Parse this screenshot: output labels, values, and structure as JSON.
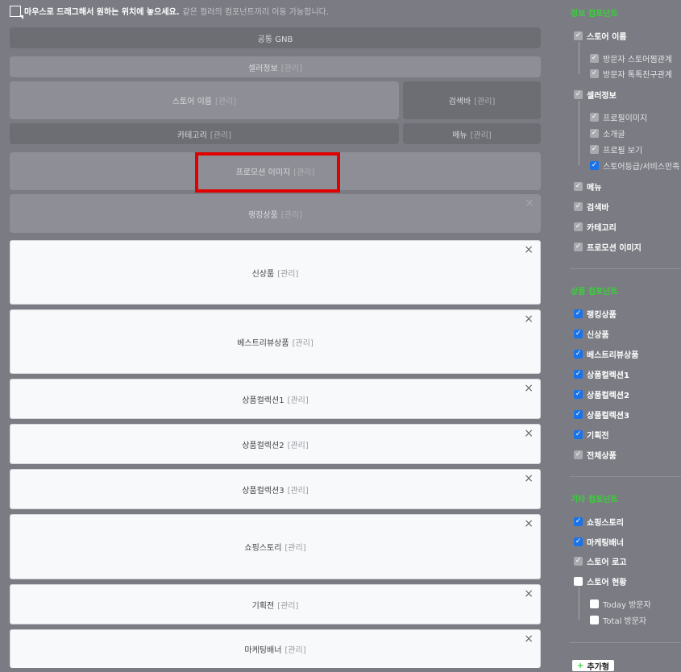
{
  "hint": {
    "main": "마우스로 드래그해서 원하는 위치에 놓으세요.",
    "sub": "같은 컬러의 컴포넌트끼리 이동 가능합니다."
  },
  "manage_label": "[관리]",
  "close_glyph": "×",
  "check_glyph": "✓",
  "layout": {
    "gnb": "공통 GNB",
    "seller_info": "셀러정보",
    "store_name": "스토어 이름",
    "search_bar": "검색바",
    "category": "카테고리",
    "menu": "메뉴",
    "promo_image": "프로모션 이미지",
    "ranking": "랭킹상품"
  },
  "product_blocks": [
    "신상품",
    "베스트리뷰상품",
    "상품컬렉션1",
    "상품컬렉션2",
    "상품컬렉션3",
    "쇼핑스토리",
    "기획전",
    "마케팅배너"
  ],
  "sidebar": {
    "info_title": "정보 컴포넌트",
    "info_items": [
      {
        "label": "스토어 이름",
        "state": "grey"
      },
      {
        "label": "방문자 스토어찜관계",
        "state": "grey"
      },
      {
        "label": "방문자 톡톡친구관계",
        "state": "grey"
      },
      {
        "label": "셀러정보",
        "state": "grey"
      },
      {
        "label": "프로필이미지",
        "state": "grey"
      },
      {
        "label": "소개글",
        "state": "grey"
      },
      {
        "label": "프로필 보기",
        "state": "grey"
      },
      {
        "label": "스토어등급/서비스만족",
        "state": "on"
      },
      {
        "label": "메뉴",
        "state": "grey"
      },
      {
        "label": "검색바",
        "state": "grey"
      },
      {
        "label": "카테고리",
        "state": "grey"
      },
      {
        "label": "프로모션 이미지",
        "state": "grey"
      }
    ],
    "product_title": "상품 컴포넌트",
    "product_items": [
      {
        "label": "랭킹상품",
        "state": "on"
      },
      {
        "label": "신상품",
        "state": "on"
      },
      {
        "label": "베스트리뷰상품",
        "state": "on"
      },
      {
        "label": "상품컬렉션1",
        "state": "on"
      },
      {
        "label": "상품컬렉션2",
        "state": "on"
      },
      {
        "label": "상품컬렉션3",
        "state": "on"
      },
      {
        "label": "기획전",
        "state": "on"
      },
      {
        "label": "전체상품",
        "state": "grey"
      }
    ],
    "other_title": "기타 컴포넌트",
    "other_items": [
      {
        "label": "쇼핑스토리",
        "state": "on"
      },
      {
        "label": "마케팅배너",
        "state": "on"
      },
      {
        "label": "스토어 로고",
        "state": "grey"
      },
      {
        "label": "스토어 현황",
        "state": "off"
      },
      {
        "label": "Today 방문자",
        "state": "off"
      },
      {
        "label": "Total 방문자",
        "state": "off"
      }
    ],
    "add_button": "추가형"
  },
  "colors": {
    "accent_green": "#39d039",
    "highlight_red": "#e10000",
    "checkbox_blue": "#1a73e8"
  }
}
